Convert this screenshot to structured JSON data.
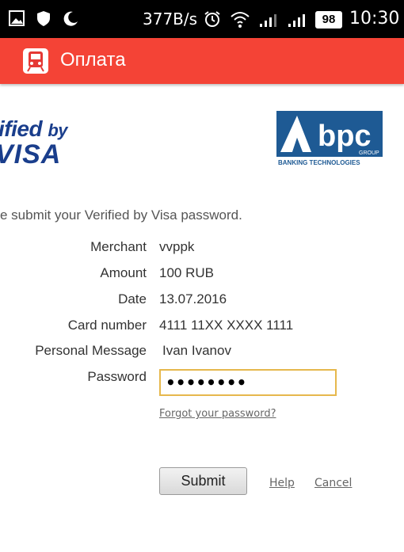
{
  "status_bar": {
    "network_speed": "377B/s",
    "battery": "98",
    "time": "10:30"
  },
  "app_bar": {
    "title": "Оплата"
  },
  "logos": {
    "vbv_line1": "ified",
    "vbv_by": "by",
    "vbv_line2": "VISA",
    "bpc_name": "bpc",
    "bpc_group": "GROUP",
    "bpc_tagline": "BANKING TECHNOLOGIES"
  },
  "intro": "e submit your Verified by Visa password.",
  "details": [
    {
      "label": "Merchant",
      "value": "vvppk"
    },
    {
      "label": "Amount",
      "value": "100 RUB"
    },
    {
      "label": "Date",
      "value": "13.07.2016"
    },
    {
      "label": "Card number",
      "value": "4111 11XX XXXX 1111"
    },
    {
      "label": "Personal Message",
      "value": "Ivan  Ivanov"
    }
  ],
  "password": {
    "label": "Password",
    "value": "••••••••"
  },
  "forgot_link": "Forgot your password?",
  "actions": {
    "submit": "Submit",
    "help": "Help",
    "cancel": "Cancel"
  },
  "colors": {
    "app_bar": "#f44336",
    "visa_blue": "#1a3e8c",
    "input_border": "#e6b84d"
  }
}
